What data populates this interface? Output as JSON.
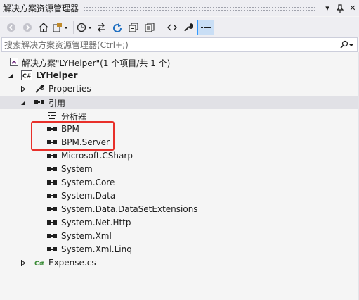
{
  "window": {
    "title": "解决方案资源管理器",
    "dropdown_glyph": "▾",
    "pin_glyph": "📌",
    "close_glyph": "✕"
  },
  "toolbar": {
    "items": [
      "back",
      "forward",
      "home",
      "switch-views",
      "pending-changes",
      "sync",
      "refresh",
      "collapse-all",
      "show-all-files",
      "preview",
      "properties",
      "active"
    ]
  },
  "search": {
    "placeholder": "搜索解决方案资源管理器(Ctrl+;)",
    "value": ""
  },
  "tree": {
    "solution": "解决方案\"LYHelper\"(1 个项目/共 1 个)",
    "project": "LYHelper",
    "properties": "Properties",
    "references": "引用",
    "analyzers": "分析器",
    "refs": [
      "BPM",
      "BPM.Server",
      "Microsoft.CSharp",
      "System",
      "System.Core",
      "System.Data",
      "System.Data.DataSetExtensions",
      "System.Net.Http",
      "System.Xml",
      "System.Xml.Linq"
    ],
    "file": "Expense.cs"
  },
  "colors": {
    "highlight": "#e8302a",
    "accent": "#3399ff",
    "background": "#f5f5f5"
  }
}
